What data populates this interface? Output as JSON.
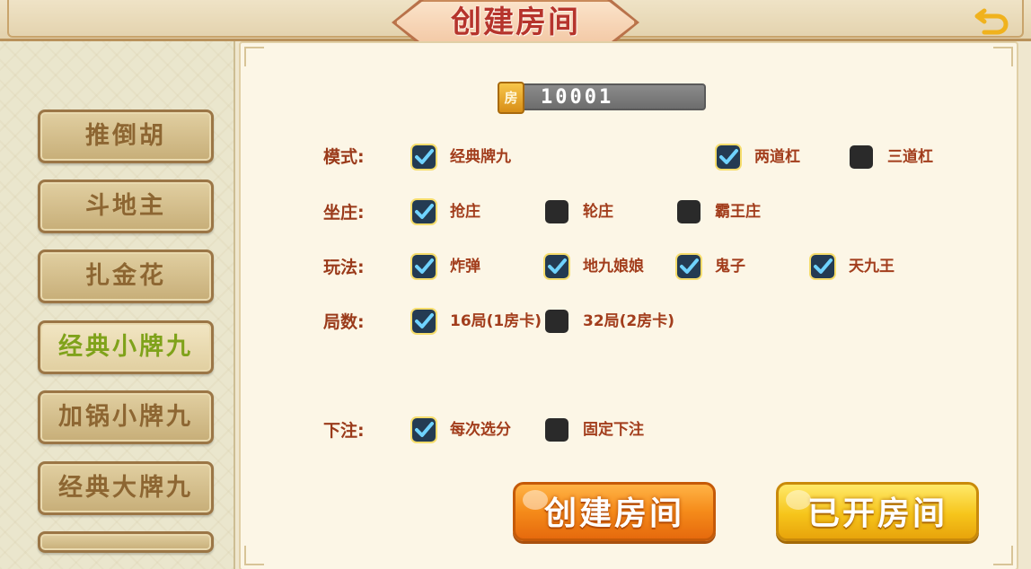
{
  "header": {
    "title": "创建房间"
  },
  "sidebar": {
    "items": [
      {
        "label": "推倒胡"
      },
      {
        "label": "斗地主"
      },
      {
        "label": "扎金花"
      },
      {
        "label": "经典小牌九"
      },
      {
        "label": "加锅小牌九"
      },
      {
        "label": "经典大牌九"
      }
    ]
  },
  "room": {
    "icon_label": "房",
    "number": "10001"
  },
  "options": {
    "mode": {
      "label": "模式:",
      "choices": [
        {
          "label": "经典牌九",
          "checked": true
        },
        {
          "label": "两道杠",
          "checked": true
        },
        {
          "label": "三道杠",
          "checked": false
        }
      ]
    },
    "banker": {
      "label": "坐庄:",
      "choices": [
        {
          "label": "抢庄",
          "checked": true
        },
        {
          "label": "轮庄",
          "checked": false
        },
        {
          "label": "霸王庄",
          "checked": false
        }
      ]
    },
    "play": {
      "label": "玩法:",
      "choices": [
        {
          "label": "炸弹",
          "checked": true
        },
        {
          "label": "地九娘娘",
          "checked": true
        },
        {
          "label": "鬼子",
          "checked": true
        },
        {
          "label": "天九王",
          "checked": true
        }
      ]
    },
    "rounds": {
      "label": "局数:",
      "choices": [
        {
          "label": "16局(1房卡)",
          "checked": true
        },
        {
          "label": "32局(2房卡)",
          "checked": false
        }
      ]
    },
    "bet": {
      "label": "下注:",
      "choices": [
        {
          "label": "每次选分",
          "checked": true
        },
        {
          "label": "固定下注",
          "checked": false
        }
      ]
    }
  },
  "buttons": {
    "create_label": "创建房间",
    "opened_label": "已开房间"
  },
  "colors": {
    "accent_orange": "#f58b1a",
    "accent_yellow": "#f6c51b",
    "label_red": "#9a3a1a"
  }
}
